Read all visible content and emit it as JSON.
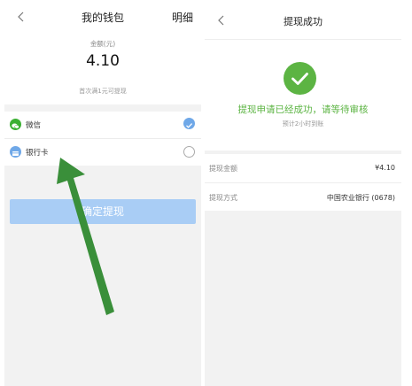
{
  "wallet": {
    "title": "我的钱包",
    "detail_link": "明细",
    "balance_label": "金额(元)",
    "balance_amount": "4.10",
    "min_hint": "首次满1元可提现",
    "options": [
      {
        "label": "微信",
        "icon": "wechat-icon",
        "icon_color": "#3cb034",
        "selected": true
      },
      {
        "label": "银行卡",
        "icon": "bank-card-icon",
        "icon_color": "#6fa8e8",
        "selected": false
      }
    ],
    "confirm_label": "确定提现",
    "confirm_color": "#a9cdf5",
    "check_color": "#6fa8e8"
  },
  "success_page": {
    "title": "提现成功",
    "message": "提现申请已经成功，请等待审核",
    "eta": "预计2小时到账",
    "accent": "#5cb443",
    "rows": [
      {
        "key": "提现金额",
        "value": "¥4.10"
      },
      {
        "key": "提现方式",
        "value": "中国农业银行 (0678)"
      }
    ]
  },
  "annotation": {
    "color": "#3a8f3a",
    "icon": "green-arrow-annotation"
  }
}
